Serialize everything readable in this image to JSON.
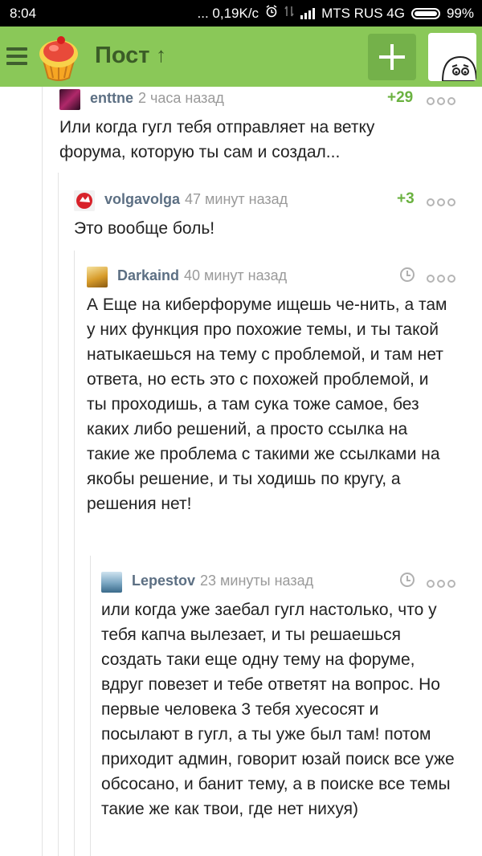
{
  "status_bar": {
    "time": "8:04",
    "net_speed": "... 0,19K/c",
    "carrier": "MTS RUS 4G",
    "battery": "99%"
  },
  "app_bar": {
    "title": "Пост",
    "title_arrow": "↑",
    "brand_color": "#8ac858"
  },
  "comments": [
    {
      "user": "enttne",
      "time": "2 часа назад",
      "score": "+29",
      "text": "Или когда гугл тебя отправляет на ветку форума, которую ты сам и создал..."
    },
    {
      "user": "volgavolga",
      "time": "47 минут назад",
      "score": "+3",
      "text": "Это вообще боль!"
    },
    {
      "user": "Darkaind",
      "time": "40 минут назад",
      "text": "А Еще на киберфоруме ищешь че-нить, а там у них функция про похожие темы, и ты такой натыкаешься на тему с проблемой, и там нет ответа, но есть это с похожей проблемой, и ты проходишь, а там сука тоже самое, без каких либо решений, а просто ссылка на такие же проблема с такими же ссылками на якобы решение, и ты ходишь по кругу, а решения нет!"
    },
    {
      "user": "Lepestov",
      "time": "23 минуты назад",
      "text": "или когда уже заебал гугл настолько, что у тебя капча вылезает, и ты решаешься создать таки еще одну тему на форуме, вдруг повезет и тебе ответят на вопрос. Но первые человека 3 тебя хуесосят и посылают в гугл, а ты уже был там! потом приходит админ, говорит юзай поиск все уже обсосано, и банит тему, а в поиске все темы такие же как твои, где нет нихуя)"
    }
  ]
}
